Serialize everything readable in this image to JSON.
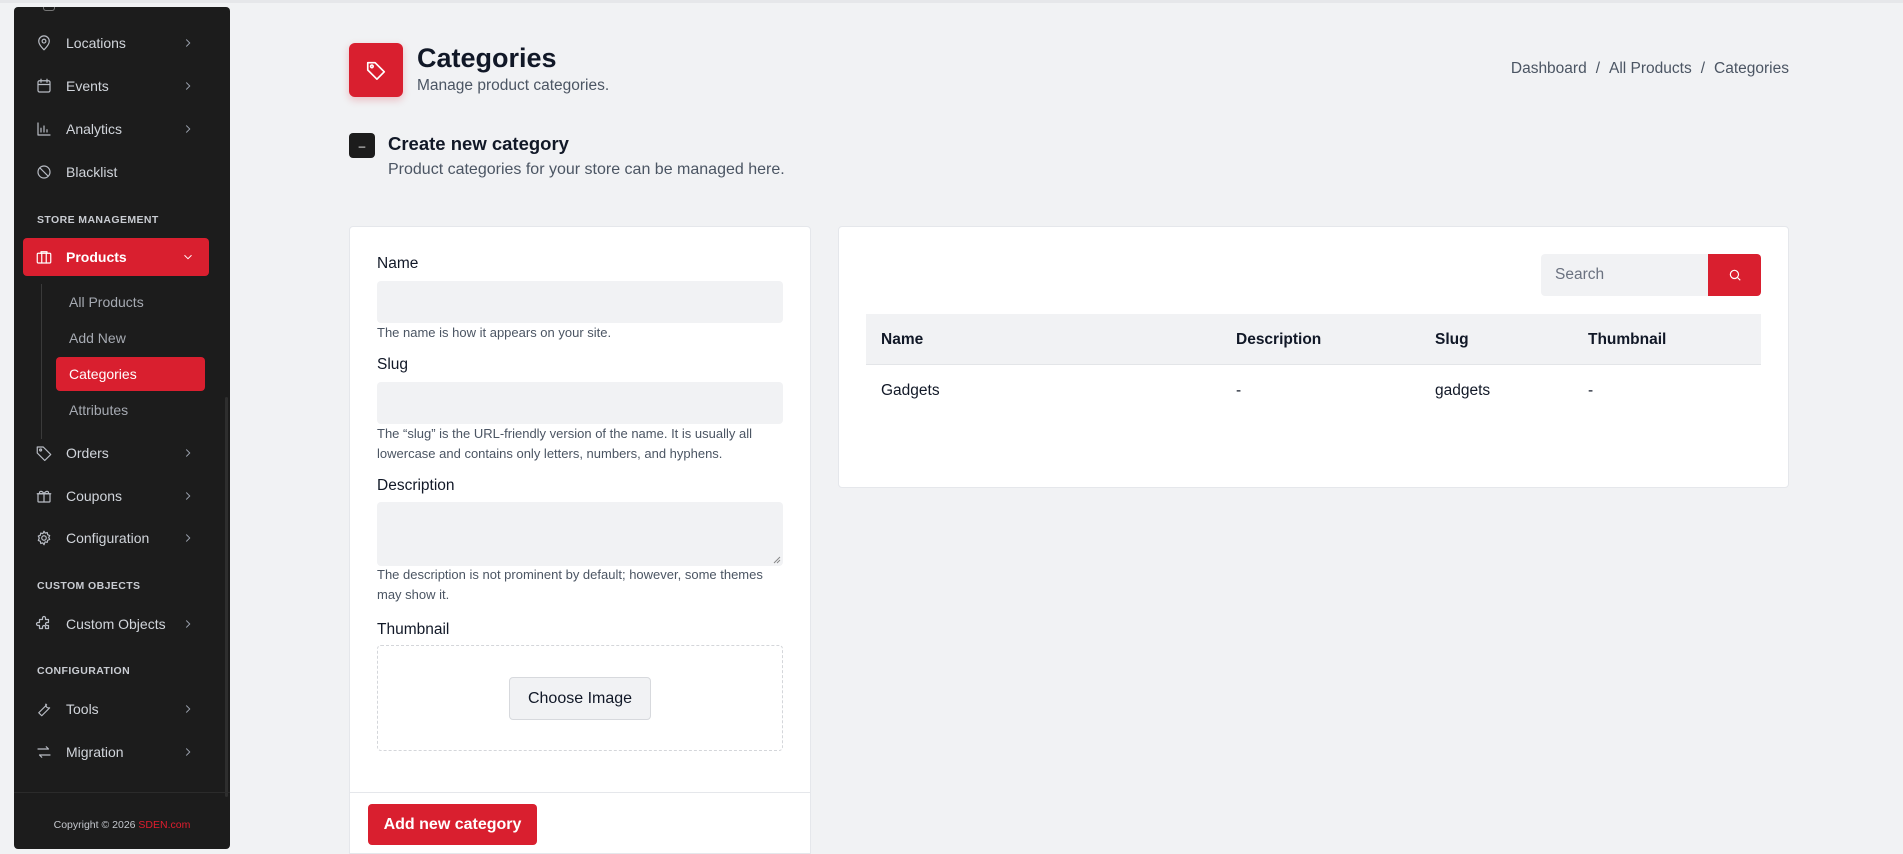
{
  "sidebar": {
    "items": [
      {
        "label": "Locations",
        "icon": "map-pin-icon"
      },
      {
        "label": "Events",
        "icon": "calendar-icon"
      },
      {
        "label": "Analytics",
        "icon": "bar-chart-icon"
      },
      {
        "label": "Blacklist",
        "icon": "ban-icon"
      }
    ],
    "section_store": "STORE MANAGEMENT",
    "products": {
      "label": "Products",
      "icon": "briefcase-icon"
    },
    "product_subitems": [
      {
        "label": "All Products"
      },
      {
        "label": "Add New"
      },
      {
        "label": "Categories"
      },
      {
        "label": "Attributes"
      }
    ],
    "store_items": [
      {
        "label": "Orders",
        "icon": "tag-icon"
      },
      {
        "label": "Coupons",
        "icon": "gift-icon"
      },
      {
        "label": "Configuration",
        "icon": "gear-icon"
      }
    ],
    "section_custom": "CUSTOM OBJECTS",
    "custom_objects": {
      "label": "Custom Objects",
      "icon": "puzzle-icon"
    },
    "section_config": "CONFIGURATION",
    "config_items": [
      {
        "label": "Tools",
        "icon": "wrench-icon"
      },
      {
        "label": "Migration",
        "icon": "arrows-swap-icon"
      }
    ],
    "footer_text": "Copyright © 2026 ",
    "footer_brand": "SDEN.com"
  },
  "header": {
    "title": "Categories",
    "subtitle": "Manage product categories.",
    "breadcrumb": [
      "Dashboard",
      "All Products",
      "Categories"
    ],
    "separator": "/"
  },
  "section": {
    "icon_glyph": "–",
    "title": "Create new category",
    "subtitle": "Product categories for your store can be managed here."
  },
  "form": {
    "name_label": "Name",
    "name_value": "",
    "name_help": "The name is how it appears on your site.",
    "slug_label": "Slug",
    "slug_value": "",
    "slug_help": "The “slug” is the URL-friendly version of the name. It is usually all lowercase and contains only letters, numbers, and hyphens.",
    "description_label": "Description",
    "description_value": "",
    "description_help": "The description is not prominent by default; however, some themes may show it.",
    "thumbnail_label": "Thumbnail",
    "choose_image": "Choose Image",
    "submit": "Add new category"
  },
  "table": {
    "search_placeholder": "Search",
    "columns": [
      "Name",
      "Description",
      "Slug",
      "Thumbnail"
    ],
    "rows": [
      [
        "Gadgets",
        "-",
        "gadgets",
        "-"
      ]
    ]
  },
  "colors": {
    "accent": "#d91f2f",
    "sidebar_bg": "#1c1c1c",
    "page_bg": "#f1f2f4"
  }
}
